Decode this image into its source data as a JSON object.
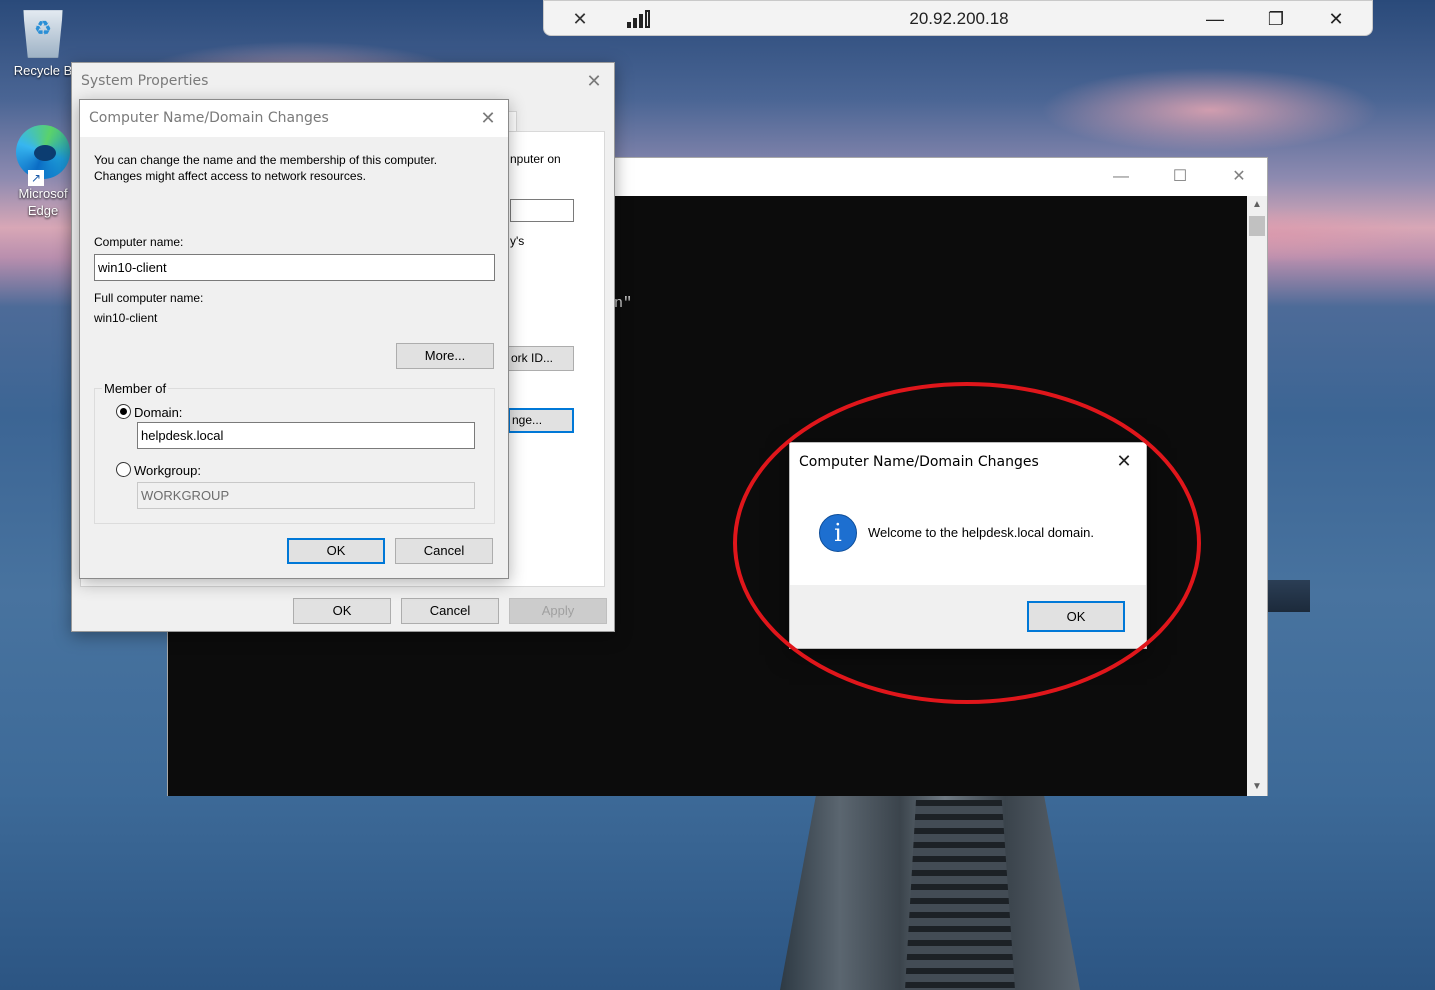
{
  "desktop": {
    "icons": [
      {
        "label": "Recycle B",
        "icon": "recycle-bin-icon"
      },
      {
        "label": "Microsof\nEdge",
        "label_line1": "Microsof",
        "label_line2": "Edge",
        "icon": "edge-icon"
      }
    ]
  },
  "rdp_bar": {
    "title": "20.92.200.18",
    "pin_icon": "pin-icon",
    "signal_icon": "connection-signal-icon",
    "minimize": "—",
    "restore": "❐",
    "close": "✕"
  },
  "console": {
    "visible_text": "n\"",
    "minimize": "—",
    "maximize": "☐",
    "close": "✕",
    "scroll_up": "▲",
    "scroll_down": "▼"
  },
  "system_properties": {
    "title": "System Properties",
    "close": "✕",
    "fragments": {
      "computer_on": "nputer on",
      "apostrophe_s": "y's",
      "network_id_button": "ork ID...",
      "change_button": "nge..."
    },
    "buttons": {
      "ok": "OK",
      "cancel": "Cancel",
      "apply": "Apply"
    }
  },
  "computer_name_dialog": {
    "title": "Computer Name/Domain Changes",
    "close": "✕",
    "intro_line1": "You can change the name and the membership of this computer.",
    "intro_line2": "Changes might affect access to network resources.",
    "computer_name_label": "Computer name:",
    "computer_name_value": "win10-client",
    "full_name_label": "Full computer name:",
    "full_name_value": "win10-client",
    "more_button": "More...",
    "member_of_label": "Member of",
    "domain_label": "Domain:",
    "domain_value": "helpdesk.local",
    "domain_selected": true,
    "workgroup_label": "Workgroup:",
    "workgroup_value": "WORKGROUP",
    "ok_button": "OK",
    "cancel_button": "Cancel"
  },
  "welcome_dialog": {
    "title": "Computer Name/Domain Changes",
    "close": "✕",
    "icon": "information-icon",
    "icon_glyph": "i",
    "message": "Welcome to the helpdesk.local domain.",
    "ok_button": "OK",
    "highlight_color": "#e0161b"
  },
  "colors": {
    "accent": "#0078d7",
    "dialog_bg": "#f0f0f0",
    "console_bg": "#0c0c0c"
  }
}
